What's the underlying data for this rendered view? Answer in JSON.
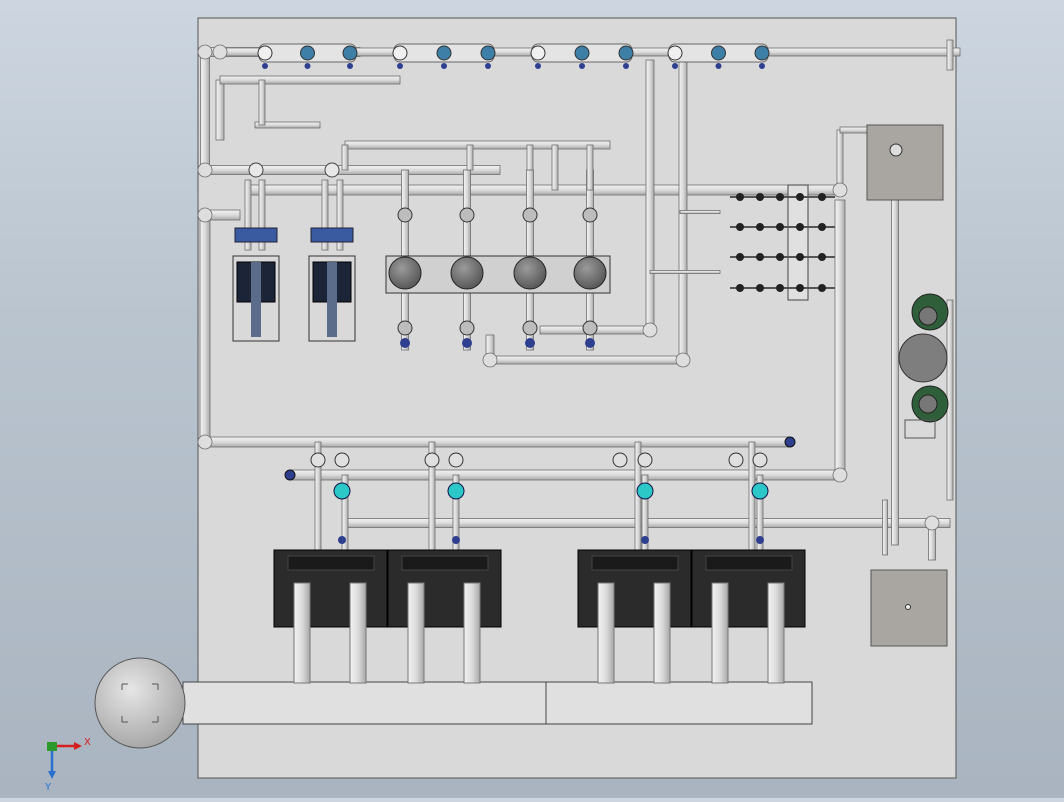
{
  "viewport": {
    "background": "#b9c4cf",
    "panel_color": "#d9d9d9",
    "pipe_color": "#e2e2e2",
    "pipe_outline": "#6f6f6f",
    "tank_color": "#2b2b2b",
    "valve_blue": "#2f3f8f",
    "sensor_cyan": "#2cc7c7",
    "filter_green": "#2f5f3a"
  },
  "model": {
    "pumps": 4,
    "filter_housings": 2,
    "tanks": 4,
    "manifold_rows": 4,
    "side_boxes": 2
  },
  "triad": {
    "x_label": "X",
    "y_label": "Y",
    "x_color": "#d42020",
    "y_color": "#2a6fd0",
    "z_color": "#2a9a2a"
  }
}
